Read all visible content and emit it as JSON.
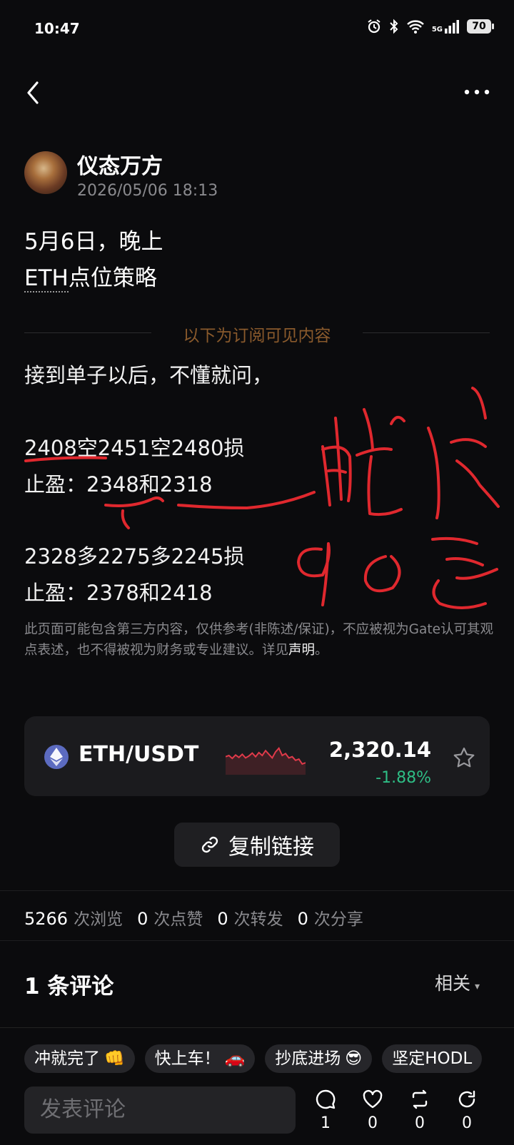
{
  "status_bar": {
    "time": "10:47",
    "network": "5G",
    "battery": "70"
  },
  "author": {
    "name": "仪态万方",
    "time": "2026/05/06 18:13"
  },
  "post": {
    "title_line1": "5月6日，晚上",
    "title_eth": "ETH",
    "title_rest": "点位策略",
    "subscribe_divider": "以下为订阅可见内容",
    "lines": [
      "接到单子以后，不懂就问，",
      "2408空2451空2480损",
      "止盈：2348和2318",
      "2328多2275多2245损",
      "止盈：2378和2418"
    ],
    "disclaimer": "此页面可能包含第三方内容，仅供参考(非陈述/保证)，不应被视为Gate认可其观点表述，也不得被视为财务或专业建议。详见",
    "disclaimer_link": "声明",
    "disclaimer_end": "。"
  },
  "market": {
    "pair": "ETH/USDT",
    "price": "2,320.14",
    "change": "-1.88%",
    "sparkline": [
      0.55,
      0.5,
      0.62,
      0.48,
      0.58,
      0.45,
      0.6,
      0.52,
      0.4,
      0.55,
      0.38,
      0.5,
      0.3,
      0.45,
      0.6,
      0.35,
      0.2,
      0.5,
      0.42,
      0.6,
      0.55,
      0.7,
      0.65,
      0.85,
      0.8
    ]
  },
  "copy_link": {
    "label": "复制链接"
  },
  "stats": [
    {
      "n": "5266",
      "label": "次浏览"
    },
    {
      "n": "0",
      "label": "次点赞"
    },
    {
      "n": "0",
      "label": "次转发"
    },
    {
      "n": "0",
      "label": "次分享"
    }
  ],
  "comments": {
    "heading": "1 条评论",
    "sort": "相关"
  },
  "chips": [
    {
      "text": "冲就完了",
      "emoji": "👊"
    },
    {
      "text": "快上车！",
      "emoji": "🚗"
    },
    {
      "text": "抄底进场",
      "emoji": "😎"
    },
    {
      "text": "坚定HODL",
      "emoji": ""
    }
  ],
  "comment_input": {
    "placeholder": "发表评论"
  },
  "actions": [
    {
      "icon": "comment-icon",
      "count": "1"
    },
    {
      "icon": "heart-icon",
      "count": "0"
    },
    {
      "icon": "repost-icon",
      "count": "0"
    },
    {
      "icon": "share-icon",
      "count": "0"
    }
  ],
  "handwriting": {
    "text": "晚吃 90岁",
    "color": "#e0282e"
  },
  "colors": {
    "up": "#2ebd85",
    "down": "#e03a4a",
    "subscribe": "#8a5a2c"
  }
}
